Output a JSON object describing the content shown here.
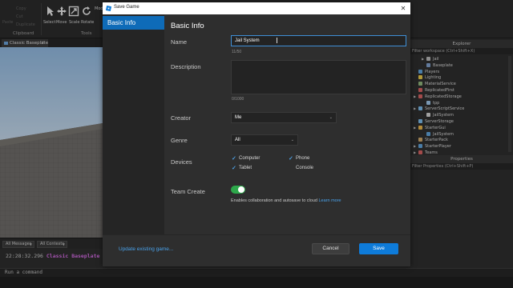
{
  "ribbon": {
    "clipboard_items": [
      "Copy",
      "Cut",
      "Duplicate"
    ],
    "paste_label": "Paste",
    "tools": [
      "Select",
      "Move",
      "Scale",
      "Rotate"
    ],
    "mode_label": "Mode",
    "groups": {
      "clipboard": "Clipboard",
      "tools": "Tools"
    }
  },
  "document_tab": {
    "label": "Classic Baseplate",
    "close": "×"
  },
  "output": {
    "filter_messages": "All Messages",
    "filter_contexts": "All Contexts",
    "log_time": "22:28:32.296",
    "log_message": "Classic Baseplate auto-"
  },
  "command_bar": {
    "placeholder": "Run a command"
  },
  "explorer": {
    "title": "Explorer",
    "filter_placeholder": "Filter workspace (Ctrl+Shift+X)",
    "items": [
      {
        "label": "Jail",
        "color": "#b5b5b5"
      },
      {
        "label": "Baseplate",
        "color": "#7e9ec9"
      },
      {
        "label": "Players",
        "color": "#5fa0d6"
      },
      {
        "label": "Lighting",
        "color": "#e6c74a"
      },
      {
        "label": "MaterialService",
        "color": "#8fb37a"
      },
      {
        "label": "ReplicatedFirst",
        "color": "#d16060"
      },
      {
        "label": "ReplicatedStorage",
        "color": "#d16060"
      },
      {
        "label": "tpp",
        "color": "#9dc3e6"
      },
      {
        "label": "ServerScriptService",
        "color": "#7ab8e6"
      },
      {
        "label": "JailSystem",
        "color": "#cfcfcf"
      },
      {
        "label": "ServerStorage",
        "color": "#7ab8e6"
      },
      {
        "label": "StarterGui",
        "color": "#e6b24a"
      },
      {
        "label": "JailSystem",
        "color": "#5fa0d6"
      },
      {
        "label": "StarterPack",
        "color": "#c9a56a"
      },
      {
        "label": "StarterPlayer",
        "color": "#5fa0d6"
      },
      {
        "label": "Teams",
        "color": "#d16060"
      }
    ]
  },
  "properties": {
    "title": "Properties",
    "filter_placeholder": "Filter Properties (Ctrl+Shift+P)"
  },
  "dialog": {
    "title": "Save Game",
    "close": "✕",
    "nav": {
      "basic_info": "Basic Info"
    },
    "heading": "Basic Info",
    "name": {
      "label": "Name",
      "value": "Jail System",
      "count": "11/50"
    },
    "description": {
      "label": "Description",
      "value": "",
      "count": "0/1000"
    },
    "creator": {
      "label": "Creator",
      "value": "Me"
    },
    "genre": {
      "label": "Genre",
      "value": "All"
    },
    "devices": {
      "label": "Devices",
      "options": [
        {
          "label": "Computer",
          "checked": true
        },
        {
          "label": "Phone",
          "checked": true
        },
        {
          "label": "Tablet",
          "checked": true
        },
        {
          "label": "Console",
          "checked": false
        }
      ]
    },
    "team_create": {
      "label": "Team Create",
      "enabled": true,
      "help": "Enables collaboration and autosave to cloud",
      "learn_more": "Learn more"
    },
    "footer": {
      "update_link": "Update existing game...",
      "cancel": "Cancel",
      "save": "Save"
    }
  },
  "colors": {
    "accent": "#0e7bd9",
    "nav_selected": "#0e6bb8",
    "link": "#4aa3ec",
    "toggle_on": "#2ea84b",
    "log_message": "#d16ae0"
  }
}
